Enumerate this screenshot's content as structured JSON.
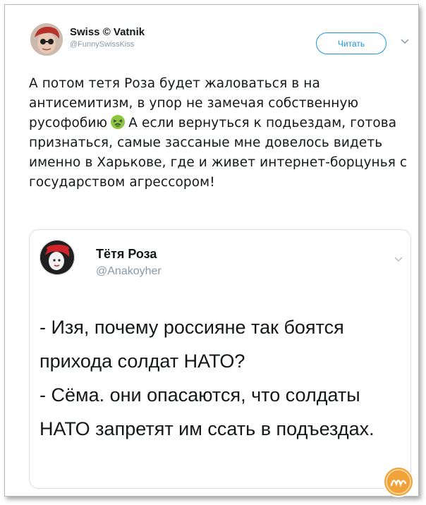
{
  "tweet": {
    "author_name": "Swiss © Vatnik",
    "author_handle": "@FunnySwissKiss",
    "follow_label": "Читать",
    "text_before_emoji": "А потом тетя Роза будет жаловаться в на антисемитизм, в упор не замечая собственную русофобию",
    "text_after_emoji": "А если вернуться к подьездам, готова признаться, самые зассаные мне довелось видеть именно в Харькове, где и живет интернет-борцунья с государством агрессором!"
  },
  "quoted_tweet": {
    "author_name": "Тётя Роза",
    "author_handle": "@Anakoyher",
    "line_1": "- Изя, почему россияне так боятся прихода солдат НАТО?",
    "line_2": "- Сёма. они опасаются, что солдаты НАТО запретят им ссать в подъездах."
  },
  "icons": {
    "menu": "chevron-down-icon",
    "emoji": "nauseated-face-emoji",
    "watermark": "logo-watermark"
  },
  "colors": {
    "accent": "#1b95e0",
    "muted": "#8899a6",
    "text": "#14171a"
  }
}
